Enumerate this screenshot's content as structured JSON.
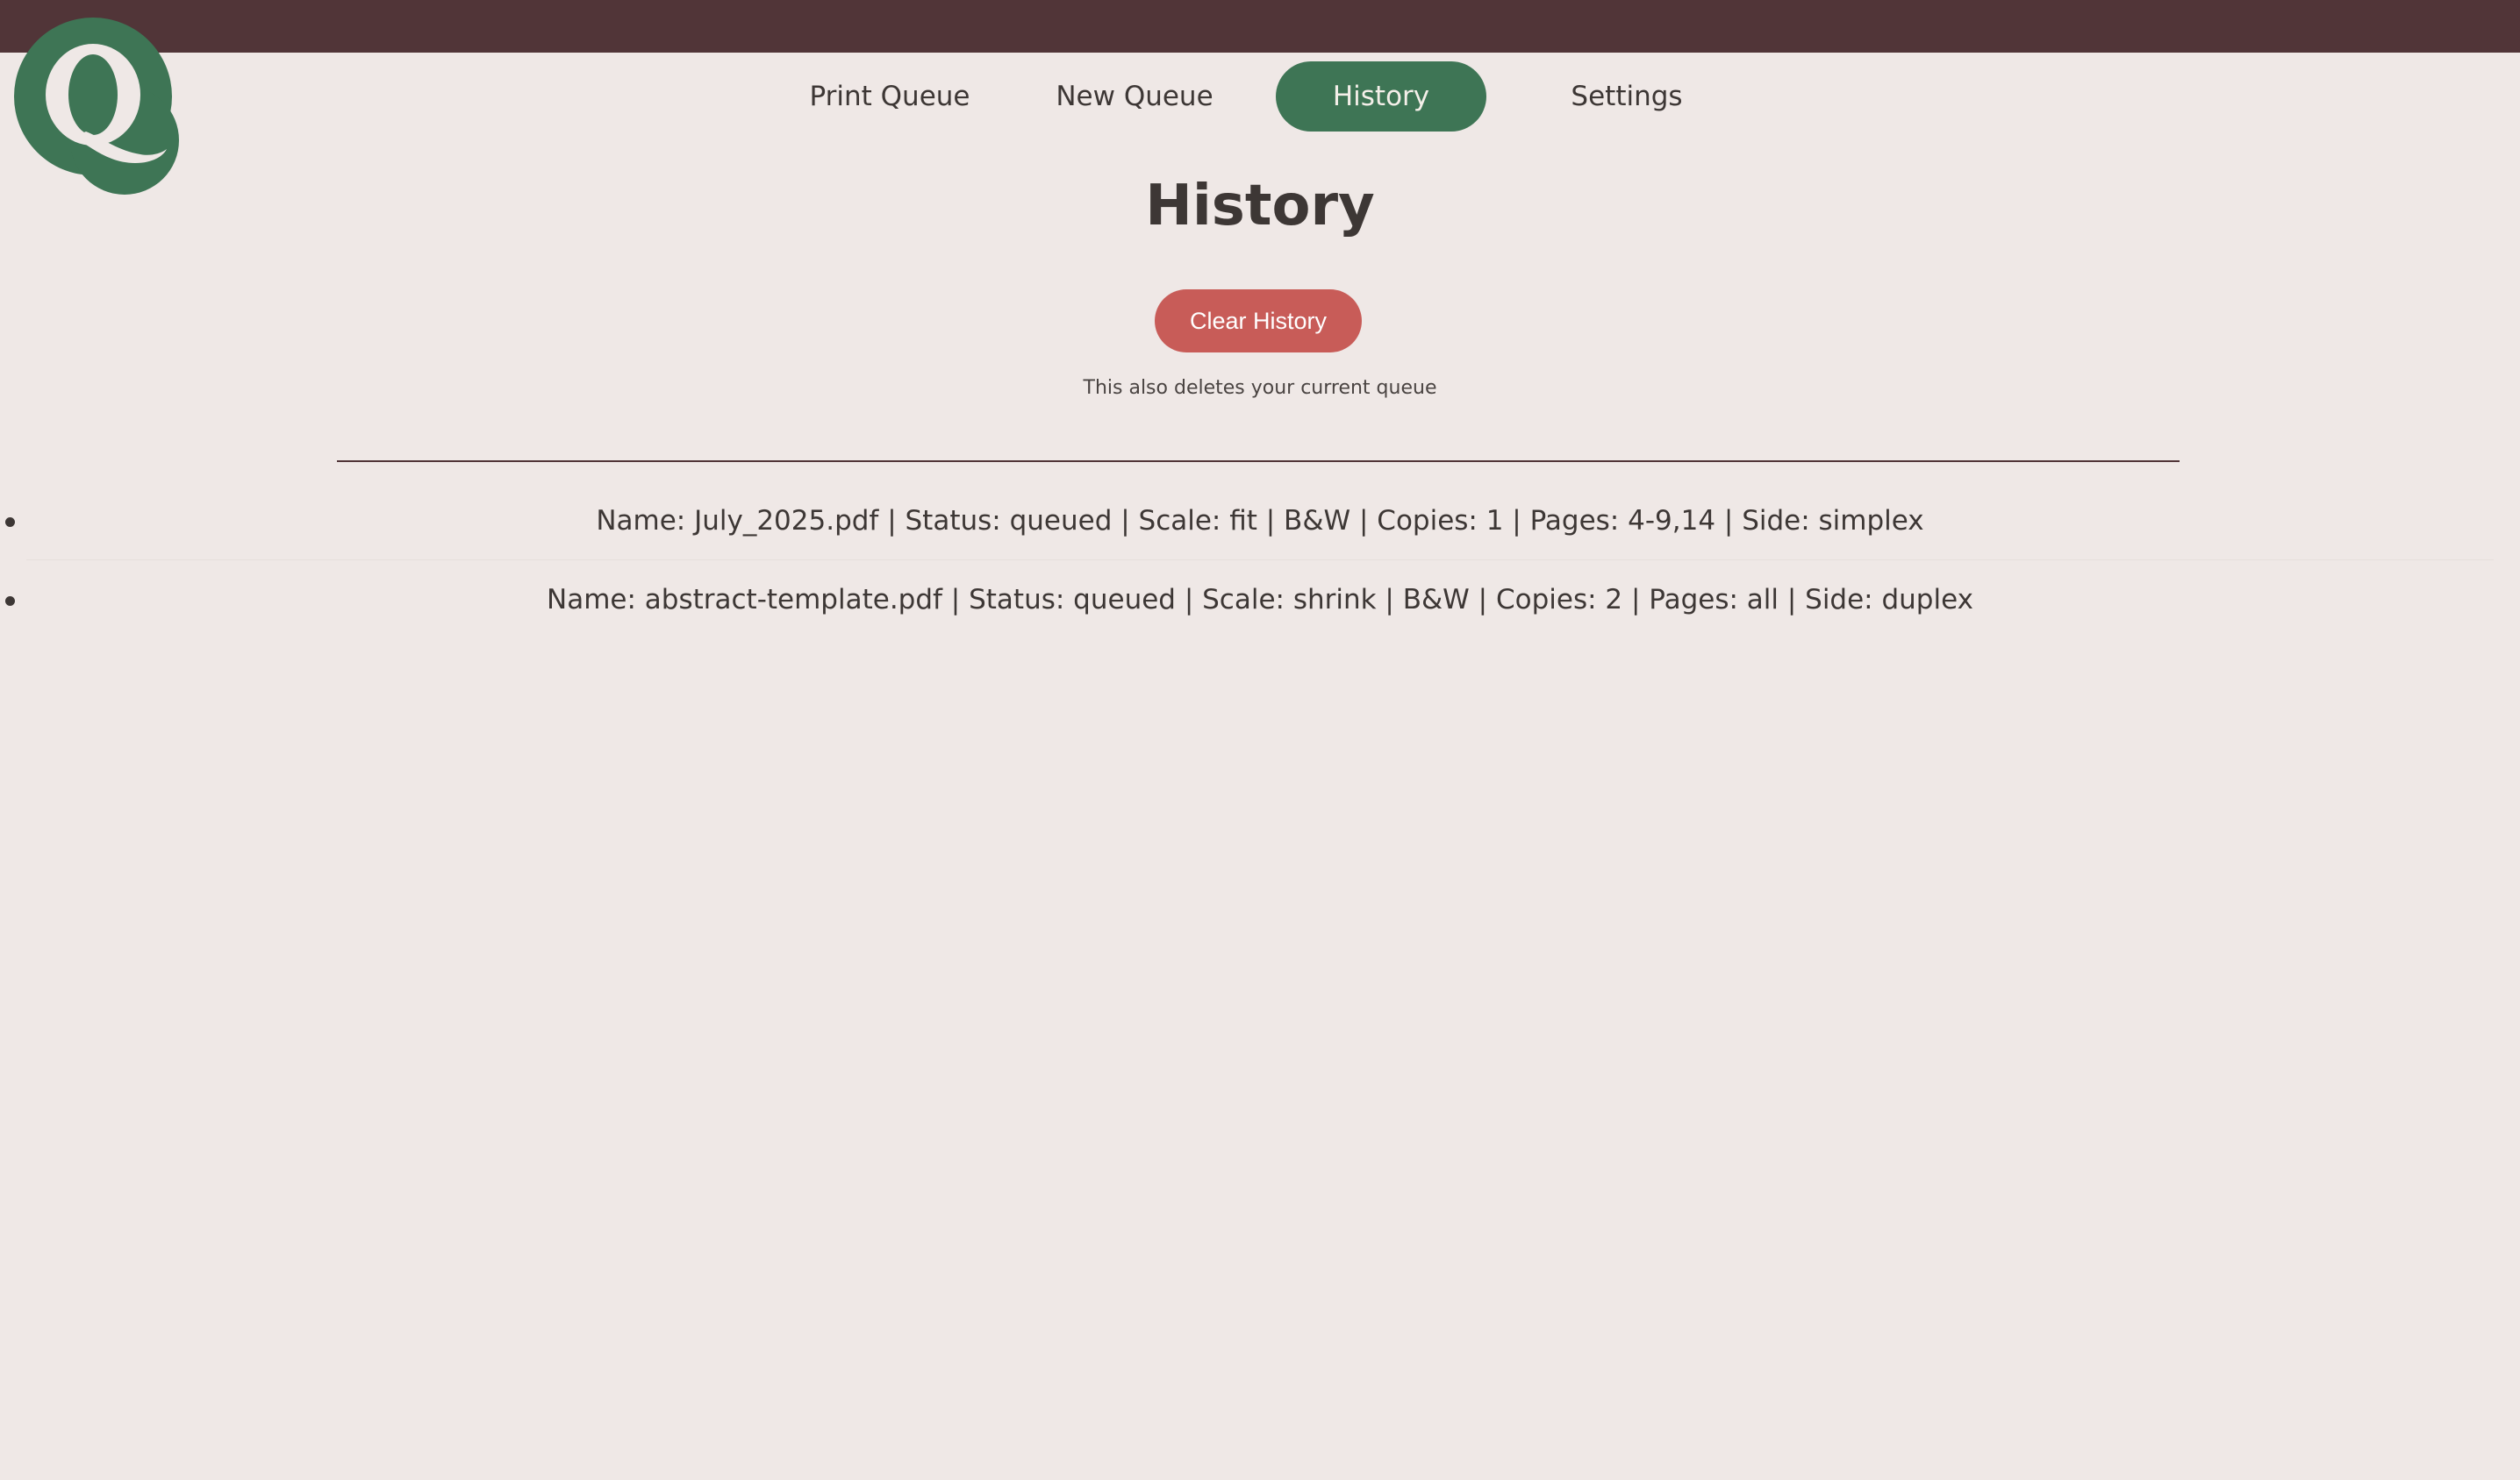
{
  "brand": {
    "logo_letter": "Q",
    "topbar_color": "#513538",
    "accent_color": "#3e7555",
    "danger_color": "#c85c58",
    "background_color": "#efe8e6"
  },
  "nav": {
    "items": [
      {
        "label": "Print Queue",
        "active": false
      },
      {
        "label": "New Queue",
        "active": false
      },
      {
        "label": "History",
        "active": true
      },
      {
        "label": "Settings",
        "active": false
      }
    ]
  },
  "page": {
    "title": "History",
    "clear_button_label": "Clear History",
    "note": "This also deletes your current queue"
  },
  "history": {
    "items": [
      "Name: July_2025.pdf | Status: queued | Scale: fit | B&W | Copies: 1 | Pages: 4-9,14 | Side: simplex",
      "Name: abstract-template.pdf | Status: queued | Scale: shrink | B&W | Copies: 2 | Pages: all | Side: duplex"
    ]
  }
}
